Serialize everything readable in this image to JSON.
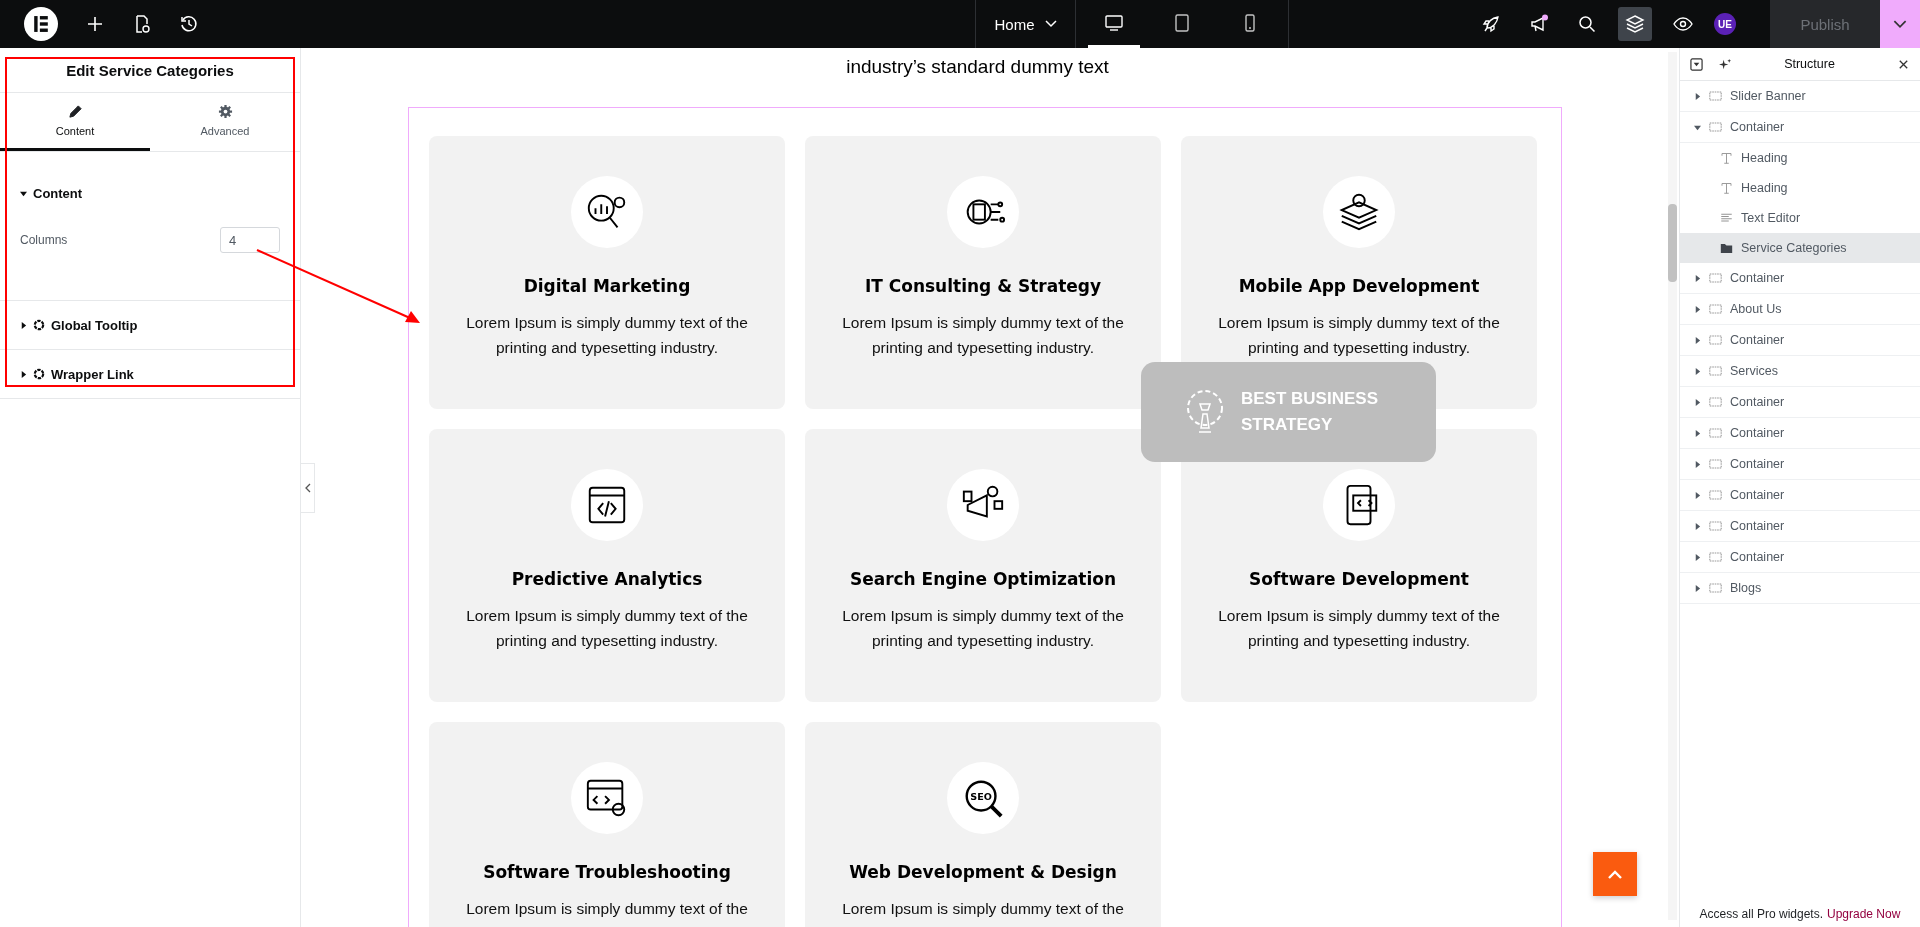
{
  "topbar": {
    "page_menu": {
      "label": "Home"
    },
    "devices": [
      {
        "kind": "desktop",
        "selected": true
      },
      {
        "kind": "tablet",
        "selected": false
      },
      {
        "kind": "mobile",
        "selected": false
      }
    ],
    "tools": [
      {
        "kind": "rocket",
        "selected": false
      },
      {
        "kind": "megaphone",
        "selected": false,
        "notification": true
      },
      {
        "kind": "search",
        "selected": false
      },
      {
        "kind": "layers",
        "selected": true
      },
      {
        "kind": "preview",
        "selected": false
      }
    ],
    "avatar": "UE",
    "publish": {
      "label": "Publish",
      "disabled": true
    }
  },
  "panel": {
    "title": "Edit Service Categories",
    "tabs": [
      {
        "label": "Content",
        "kind": "pencil",
        "selected": true
      },
      {
        "label": "Advanced",
        "kind": "gear",
        "selected": false
      }
    ],
    "sections": [
      {
        "title": "Content",
        "expanded": true,
        "pro": false,
        "fields": [
          {
            "label": "Columns",
            "value": "4"
          }
        ]
      },
      {
        "title": "Global Tooltip",
        "expanded": false,
        "pro": true
      },
      {
        "title": "Wrapper Link",
        "expanded": false,
        "pro": true
      }
    ]
  },
  "canvas": {
    "intro_text": "industry’s standard dummy text",
    "cards": [
      {
        "title": "Digital Marketing",
        "lines": [
          "Lorem Ipsum is simply dummy text of the",
          "printing and typesetting industry."
        ]
      },
      {
        "title": "IT Consulting & Strategy",
        "lines": [
          "Lorem Ipsum is simply dummy text of the",
          "printing and typesetting industry."
        ]
      },
      {
        "title": "Mobile App Development",
        "lines": [
          "Lorem Ipsum is simply dummy text of the",
          "printing and typesetting industry."
        ]
      },
      {
        "title": "Predictive Analytics",
        "lines": [
          "Lorem Ipsum is simply dummy text of the",
          "printing and typesetting industry."
        ]
      },
      {
        "title": "Search Engine Optimization",
        "lines": [
          "Lorem Ipsum is simply dummy text of the",
          "printing and typesetting industry."
        ]
      },
      {
        "title": "Software Development",
        "lines": [
          "Lorem Ipsum is simply dummy text of the",
          "printing and typesetting industry."
        ]
      },
      {
        "title": "Software Troubleshooting",
        "lines": [
          "Lorem Ipsum is simply dummy text of the"
        ]
      },
      {
        "title": "Web Development & Design",
        "lines": [
          "Lorem Ipsum is simply dummy text of the"
        ],
        "icon_text": "SEO"
      }
    ],
    "overlay": {
      "title": "BEST BUSINESS STRATEGY"
    }
  },
  "structure": {
    "title": "Structure",
    "items": [
      {
        "label": "Slider Banner",
        "kind": "container",
        "expanded": false,
        "selected": false
      },
      {
        "label": "Container",
        "kind": "container",
        "expanded": true,
        "selected": false,
        "children": [
          {
            "label": "Heading",
            "kind": "heading",
            "selected": false
          },
          {
            "label": "Heading",
            "kind": "heading",
            "selected": false
          },
          {
            "label": "Text Editor",
            "kind": "text",
            "selected": false
          },
          {
            "label": "Service Categories",
            "kind": "widget",
            "selected": true
          }
        ]
      },
      {
        "label": "Container",
        "kind": "container",
        "expanded": false,
        "selected": false
      },
      {
        "label": "About Us",
        "kind": "container",
        "expanded": false,
        "selected": false
      },
      {
        "label": "Container",
        "kind": "container",
        "expanded": false,
        "selected": false
      },
      {
        "label": "Services",
        "kind": "container",
        "expanded": false,
        "selected": false
      },
      {
        "label": "Container",
        "kind": "container",
        "expanded": false,
        "selected": false
      },
      {
        "label": "Container",
        "kind": "container",
        "expanded": false,
        "selected": false
      },
      {
        "label": "Container",
        "kind": "container",
        "expanded": false,
        "selected": false
      },
      {
        "label": "Container",
        "kind": "container",
        "expanded": false,
        "selected": false
      },
      {
        "label": "Container",
        "kind": "container",
        "expanded": false,
        "selected": false
      },
      {
        "label": "Container",
        "kind": "container",
        "expanded": false,
        "selected": false
      },
      {
        "label": "Blogs",
        "kind": "container",
        "expanded": false,
        "selected": false
      }
    ],
    "footer": {
      "text": "Access all Pro widgets.",
      "link": "Upgrade Now"
    }
  }
}
